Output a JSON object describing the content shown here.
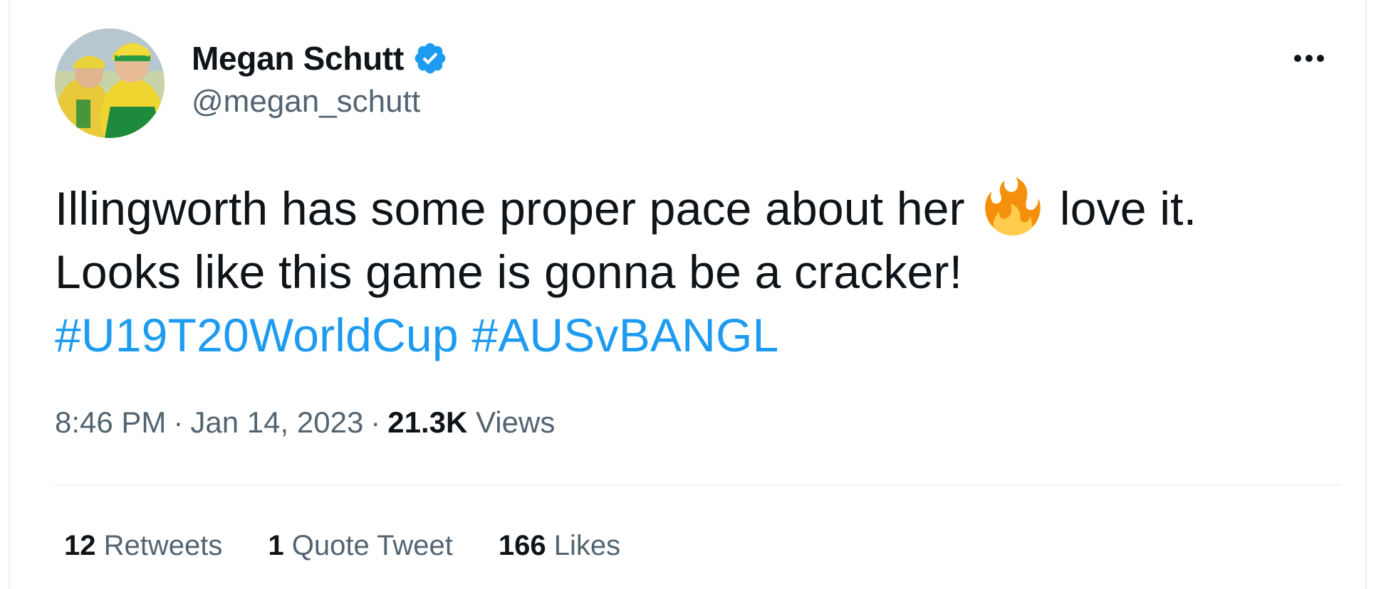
{
  "tweet": {
    "author": {
      "display_name": "Megan Schutt",
      "handle": "@megan_schutt",
      "verified": true,
      "avatar_icon": "profile-photo"
    },
    "more_icon": "more-horizontal-icon",
    "text": {
      "line1_before_emoji": "Illingworth has some proper pace about her",
      "emoji": "fire-emoji",
      "line1_after_emoji": "love it.",
      "line2": "Looks like this game is gonna be a cracker!",
      "hashtags": [
        "#U19T20WorldCup",
        "#AUSvBANGL"
      ]
    },
    "time": "8:46 PM",
    "separator": "·",
    "date": "Jan 14, 2023",
    "views_count": "21.3K",
    "views_label": "Views",
    "stats": [
      {
        "count": "12",
        "label": "Retweets"
      },
      {
        "count": "1",
        "label": "Quote Tweet"
      },
      {
        "count": "166",
        "label": "Likes"
      }
    ]
  },
  "colors": {
    "text_primary": "#0f1419",
    "text_secondary": "#536471",
    "accent": "#1d9bf0",
    "divider": "#eff3f4",
    "fire_outer": "#f4900c",
    "fire_inner": "#ffcc4d"
  }
}
